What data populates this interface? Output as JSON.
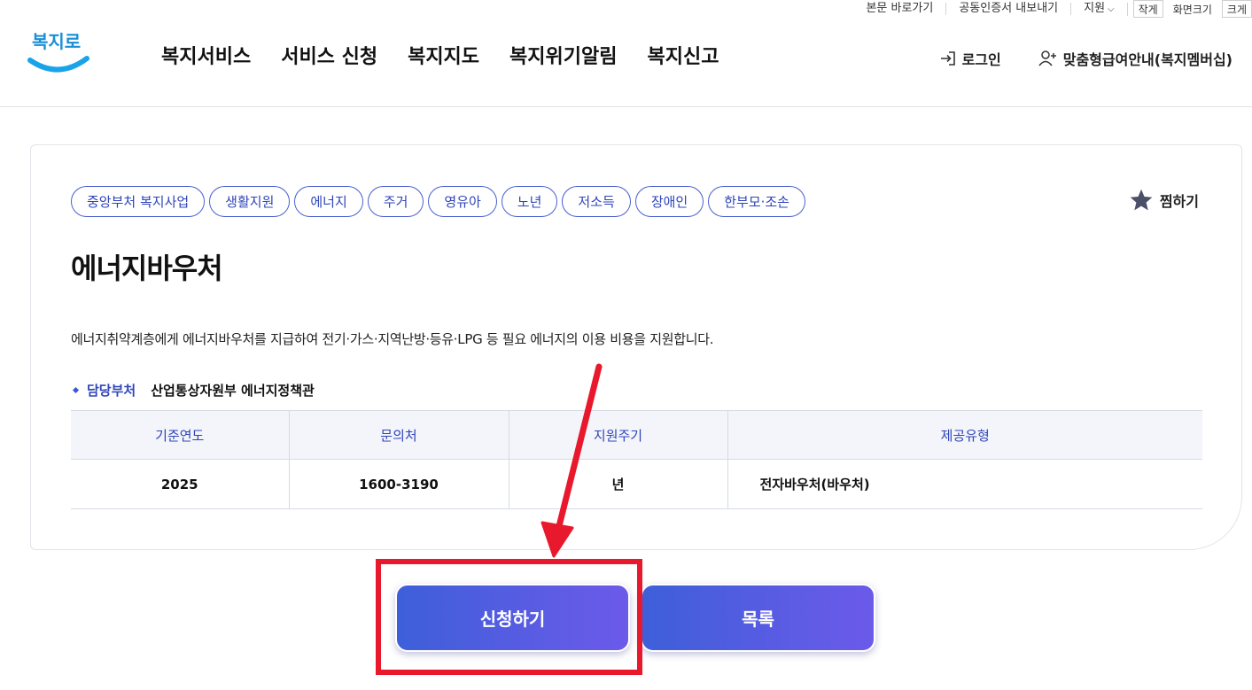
{
  "util_bar": {
    "skip_link": "본문 바로가기",
    "cert_export": "공동인증서 내보내기",
    "support": "지원",
    "size_small": "작게",
    "size_label": "화면크기",
    "size_large": "크게"
  },
  "header": {
    "logo_text": "복지로",
    "nav": [
      "복지서비스",
      "서비스 신청",
      "복지지도",
      "복지위기알림",
      "복지신고"
    ],
    "login": "로그인",
    "membership": "맞춤형급여안내(복지멤버십)"
  },
  "service": {
    "tags": [
      "중앙부처 복지사업",
      "생활지원",
      "에너지",
      "주거",
      "영유아",
      "노년",
      "저소득",
      "장애인",
      "한부모·조손"
    ],
    "favorite": "찜하기",
    "title": "에너지바우처",
    "description": "에너지취약계층에게 에너지바우처를 지급하여 전기·가스·지역난방·등유·LPG 등 필요 에너지의 이용 비용을 지원합니다.",
    "dept_label": "담당부처",
    "dept_value": "산업통상자원부 에너지정책관",
    "table": {
      "headers": [
        "기준연도",
        "문의처",
        "지원주기",
        "제공유형"
      ],
      "row": [
        "2025",
        "1600-3190",
        "년",
        "전자바우처(바우처)"
      ]
    }
  },
  "buttons": {
    "apply": "신청하기",
    "list": "목록"
  },
  "colors": {
    "accent": "#2f45b8",
    "button_gradient_start": "#3e5fd9",
    "button_gradient_end": "#6c5aea",
    "annotation": "#e8192c"
  }
}
